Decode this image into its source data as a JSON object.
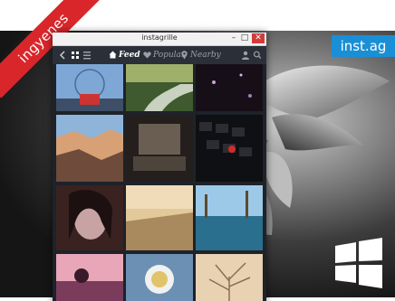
{
  "promo": {
    "ribbon_text": "ingyenes",
    "brand_badge": "inst.ag"
  },
  "window": {
    "title": "instagrille",
    "controls": {
      "minimize": "–",
      "maximize": "□",
      "close": "✕"
    }
  },
  "toolbar": {
    "tabs": [
      {
        "label": "Feed",
        "icon": "home-icon",
        "active": true
      },
      {
        "label": "Popular",
        "icon": "heart-icon",
        "active": false
      },
      {
        "label": "Nearby",
        "icon": "pin-icon",
        "active": false
      }
    ]
  },
  "feed": {
    "photos": [
      {
        "subject": "london-eye",
        "c1": "#7fa7d6",
        "c2": "#4a6c98"
      },
      {
        "subject": "forest-stream",
        "c1": "#9fb06a",
        "c2": "#3f5a2e"
      },
      {
        "subject": "night-lights",
        "c1": "#40303e",
        "c2": "#160f18"
      },
      {
        "subject": "canyon",
        "c1": "#d7a175",
        "c2": "#6e4b3a"
      },
      {
        "subject": "laptop",
        "c1": "#6a5e52",
        "c2": "#241f1c"
      },
      {
        "subject": "keyboard",
        "c1": "#2b2d33",
        "c2": "#0f1013"
      },
      {
        "subject": "portrait",
        "c1": "#c7a3a3",
        "c2": "#3a2220"
      },
      {
        "subject": "desert-road",
        "c1": "#e3c89a",
        "c2": "#a88a5e"
      },
      {
        "subject": "pool",
        "c1": "#6fb0d8",
        "c2": "#2b6f8e"
      },
      {
        "subject": "sunset-silhouette",
        "c1": "#e9a6b8",
        "c2": "#7a3c5a"
      },
      {
        "subject": "food",
        "c1": "#6c8fb4",
        "c2": "#e0c36a"
      },
      {
        "subject": "bare-tree",
        "c1": "#e8d2b2",
        "c2": "#8a6e57"
      }
    ]
  }
}
